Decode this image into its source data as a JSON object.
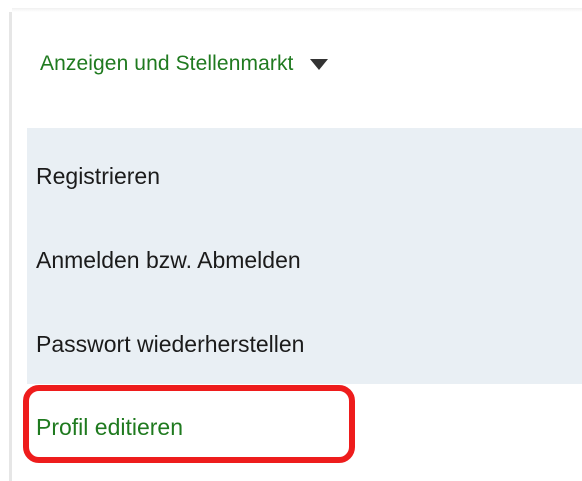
{
  "menu": {
    "header_label": "Anzeigen und Stellenmarkt",
    "header_icon": "caret-down-icon",
    "items": [
      {
        "label": "Registrieren"
      },
      {
        "label": "Anmelden bzw. Abmelden"
      },
      {
        "label": "Passwort wiederherstellen"
      },
      {
        "label": "Profil editieren"
      }
    ]
  },
  "colors": {
    "accent_green": "#1f7a1f",
    "submenu_background": "#e9eff4",
    "highlight_red": "#ee1c1c"
  }
}
